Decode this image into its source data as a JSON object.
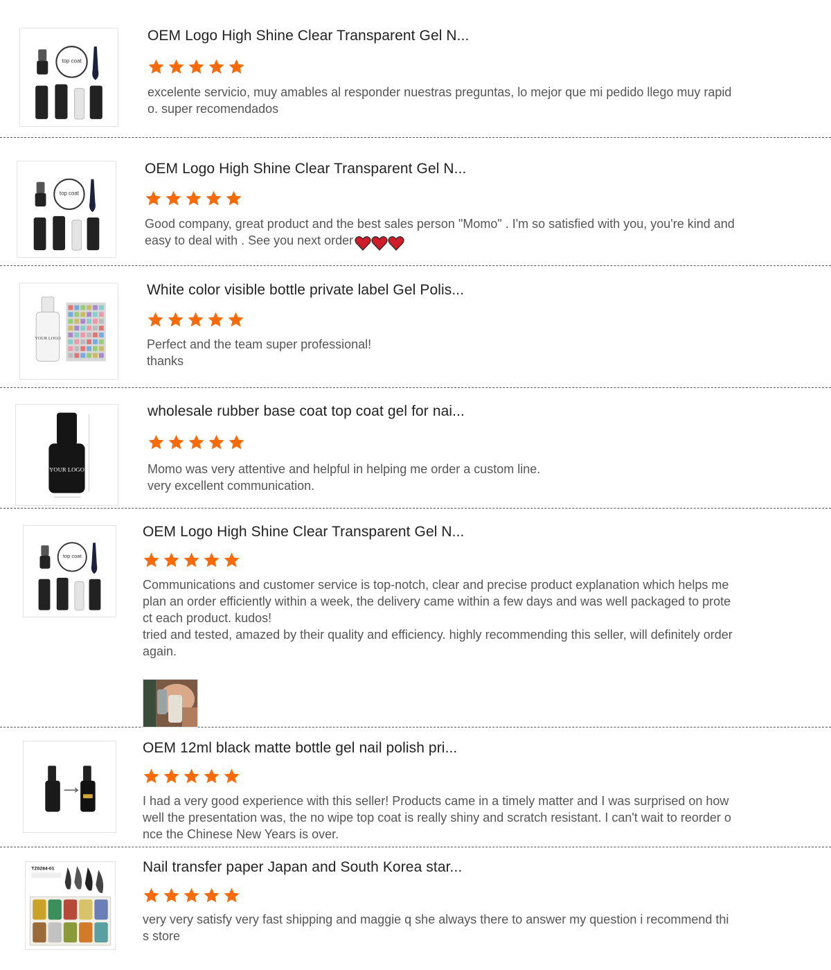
{
  "colors": {
    "star": "#f96a0a",
    "divider": "#555555",
    "heart": "#cc1e2a"
  },
  "reviews": [
    {
      "title": "OEM Logo High Shine Clear Transparent Gel N...",
      "rating": 5,
      "product_icon": "gel-polish-set-icon",
      "product_image_text": "top coat",
      "text": "excelente servicio,  muy amables al responder nuestras preguntas,  lo mejor que mi pedido llego muy rapid\no. super recomendados"
    },
    {
      "title": "OEM Logo High Shine Clear Transparent Gel N...",
      "rating": 5,
      "product_icon": "gel-polish-set-icon",
      "product_image_text": "top coat",
      "text": "Good company, great product and the best sales person \"Momo\" . I'm so satisfied with you, you're kind and\neasy to deal with . See you next order",
      "emoji": [
        "heart-icon",
        "heart-icon",
        "heart-icon"
      ]
    },
    {
      "title": "White color visible bottle private label Gel Polis...",
      "rating": 5,
      "product_icon": "white-bottle-color-chart-icon",
      "product_image_text": "YOUR LOGO",
      "text": "Perfect and the team super professional!\nthanks"
    },
    {
      "title": "wholesale rubber base coat top coat gel for nai...",
      "rating": 5,
      "product_icon": "black-bottle-icon",
      "product_image_text": "YOUR LOGO",
      "text": "Momo was very attentive and helpful in helping me order a custom line.\nvery excellent communication."
    },
    {
      "title": "OEM Logo High Shine Clear Transparent Gel N...",
      "rating": 5,
      "product_icon": "gel-polish-set-icon",
      "product_image_text": "top coat",
      "text": "Communications and customer service is top-notch, clear and precise product explanation which helps me\nplan an order efficiently within a week, the delivery came within a few days and was well packaged to prote\nct each product. kudos!\ntried and tested, amazed by their quality and efficiency. highly recommending this seller, will definitely order\nagain.",
      "photo_icon": "customer-photo-icon"
    },
    {
      "title": "OEM 12ml black matte bottle gel nail polish pri...",
      "rating": 5,
      "product_icon": "matte-bottle-comparison-icon",
      "text": "I had a very good experience with this seller! Products came in a timely matter and I was surprised on how\nwell the presentation was, the no wipe top coat is really shiny and scratch resistant. I can't wait to reorder o\nnce the Chinese New Years is over."
    },
    {
      "title": "Nail transfer paper Japan and South Korea star...",
      "rating": 5,
      "product_icon": "nail-foil-set-icon",
      "product_image_text": "TZ0284-01",
      "text": "very very satisfy very fast shipping and maggie q she always there to answer my question i recommend thi\ns store"
    }
  ]
}
